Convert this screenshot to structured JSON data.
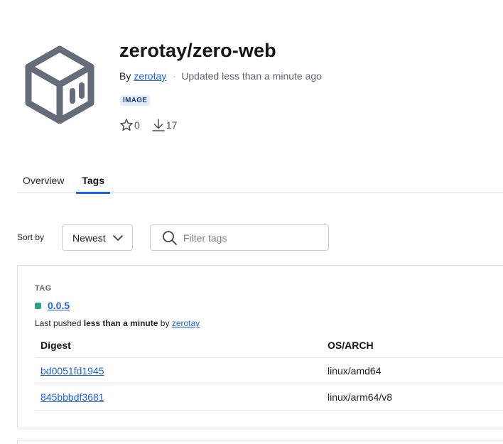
{
  "repo": {
    "title": "zerotay/zero-web",
    "by_label": "By",
    "owner": "zerotay",
    "separator": "·",
    "updated": "Updated less than a minute ago",
    "badge": "IMAGE",
    "stars": "0",
    "pulls": "17",
    "icons": {
      "logo": "package-cube-icon",
      "star": "star-icon",
      "pulls": "download-icon"
    }
  },
  "tabs": [
    {
      "label": "Overview",
      "active": false
    },
    {
      "label": "Tags",
      "active": true
    }
  ],
  "controls": {
    "sort_label": "Sort by",
    "sort_value": "Newest",
    "filter_placeholder": "Filter tags"
  },
  "tag_card": {
    "section_label": "TAG",
    "tag": "0.0.5",
    "pushed_prefix": "Last pushed",
    "pushed_when": "less than a minute",
    "pushed_by_word": "by",
    "pushed_by": "zerotay",
    "columns": [
      "Digest",
      "OS/ARCH"
    ],
    "rows": [
      {
        "digest": "bd0051fd1945",
        "os": "linux/amd64"
      },
      {
        "digest": "845bbbdf3681",
        "os": "linux/arm64/v8"
      }
    ]
  },
  "colors": {
    "accent": "#1d63ed",
    "tag_status": "#2aa38a",
    "logo": "#646b79"
  }
}
